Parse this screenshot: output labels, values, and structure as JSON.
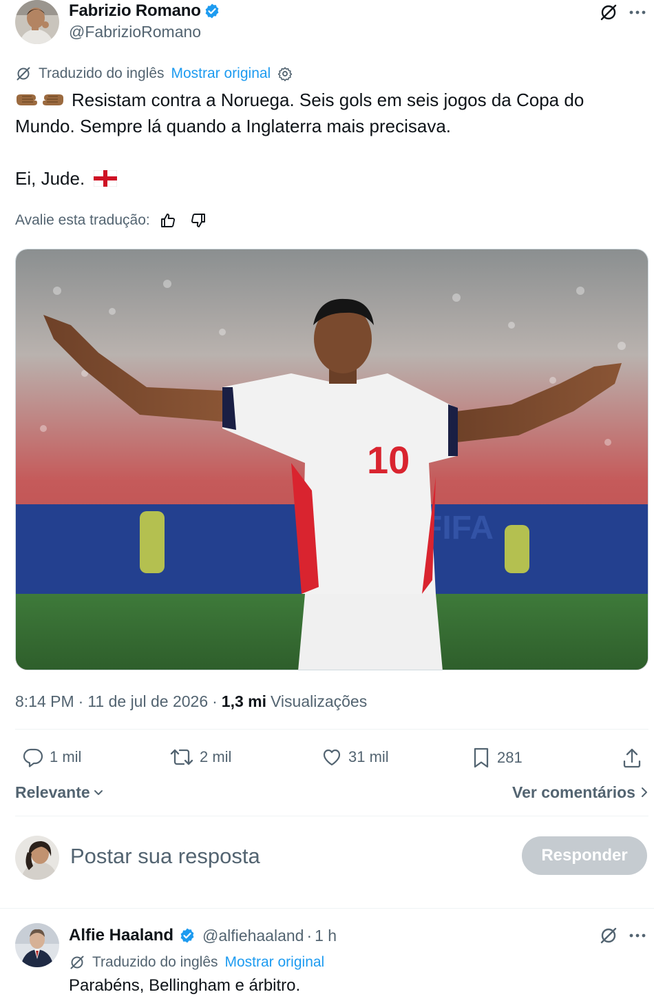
{
  "tweet": {
    "author_name": "Fabrizio Romano",
    "author_handle": "@FabrizioRomano",
    "translated_from": "Traduzido do inglês",
    "show_original": "Mostrar original",
    "line1": "Resistam contra a Noruega. Seis gols em seis jogos da Copa do Mundo. Sempre lá quando a Inglaterra mais precisava.",
    "line2": "Ei, Jude.",
    "rate_translation": "Avalie esta tradução:",
    "time": "8:14 PM",
    "separator": "·",
    "date": "11 de jul de 2026",
    "views_count": "1,3 mi",
    "views_label": "Visualizações",
    "jersey_number": "10"
  },
  "actions": {
    "replies": "1 mil",
    "retweets": "2 mil",
    "likes": "31 mil",
    "bookmarks": "281"
  },
  "sort": {
    "label": "Relevante",
    "view_comments": "Ver comentários"
  },
  "compose": {
    "placeholder": "Postar sua resposta",
    "reply_button": "Responder"
  },
  "reply": {
    "author_name": "Alfie Haaland",
    "author_handle": "@alfiehaaland",
    "time": "1 h",
    "translated_from": "Traduzido do inglês",
    "show_original": "Mostrar original",
    "text": "Parabéns, Bellingham e árbitro."
  },
  "colors": {
    "accent": "#1d9bf0",
    "muted": "#536471",
    "reply_button_disabled": "#c5cbd0"
  }
}
